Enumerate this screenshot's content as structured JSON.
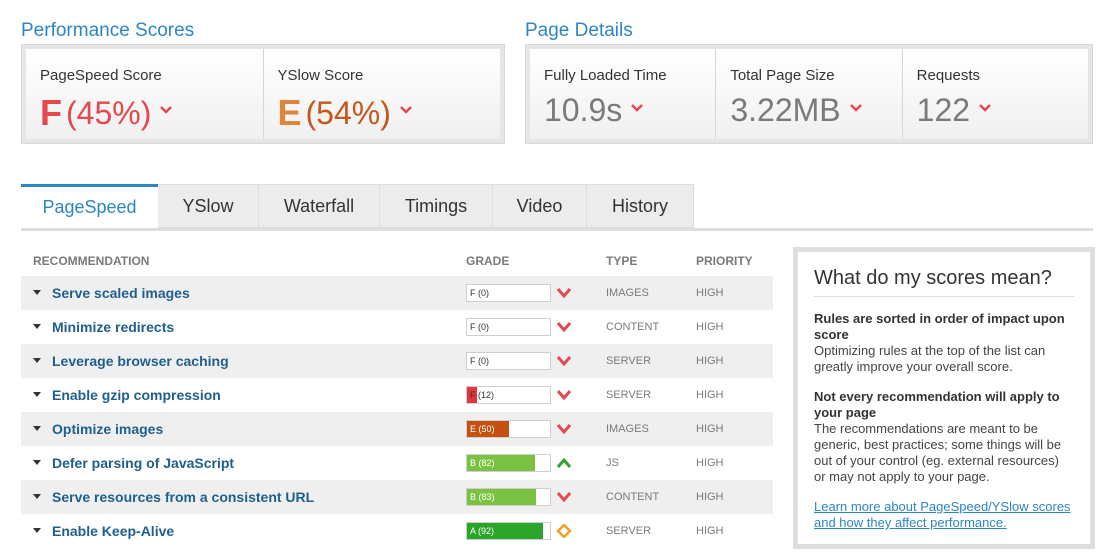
{
  "performance": {
    "title": "Performance Scores",
    "pagespeed": {
      "label": "PageSpeed Score",
      "grade": "F",
      "value": "(45%)"
    },
    "yslow": {
      "label": "YSlow Score",
      "grade": "E",
      "value": "(54%)"
    }
  },
  "details": {
    "title": "Page Details",
    "loaded": {
      "label": "Fully Loaded Time",
      "value": "10.9s"
    },
    "size": {
      "label": "Total Page Size",
      "value": "3.22MB"
    },
    "requests": {
      "label": "Requests",
      "value": "122"
    }
  },
  "tabs": [
    "PageSpeed",
    "YSlow",
    "Waterfall",
    "Timings",
    "Video",
    "History"
  ],
  "table": {
    "headers": {
      "recommendation": "RECOMMENDATION",
      "grade": "GRADE",
      "type": "TYPE",
      "priority": "PRIORITY"
    },
    "rows": [
      {
        "name": "Serve scaled images",
        "grade": "F (0)",
        "score": 0,
        "color": "#e0363c",
        "trend": "down",
        "type": "IMAGES",
        "priority": "HIGH"
      },
      {
        "name": "Minimize redirects",
        "grade": "F (0)",
        "score": 0,
        "color": "#e0363c",
        "trend": "down",
        "type": "CONTENT",
        "priority": "HIGH"
      },
      {
        "name": "Leverage browser caching",
        "grade": "F (0)",
        "score": 0,
        "color": "#e0363c",
        "trend": "down",
        "type": "SERVER",
        "priority": "HIGH"
      },
      {
        "name": "Enable gzip compression",
        "grade": "F (12)",
        "score": 12,
        "color": "#e0363c",
        "trend": "down",
        "type": "SERVER",
        "priority": "HIGH"
      },
      {
        "name": "Optimize images",
        "grade": "E (50)",
        "score": 50,
        "color": "#c4510f",
        "trend": "down",
        "type": "IMAGES",
        "priority": "HIGH"
      },
      {
        "name": "Defer parsing of JavaScript",
        "grade": "B (82)",
        "score": 82,
        "color": "#7cc242",
        "trend": "up",
        "type": "JS",
        "priority": "HIGH"
      },
      {
        "name": "Serve resources from a consistent URL",
        "grade": "B (83)",
        "score": 83,
        "color": "#7cc242",
        "trend": "down",
        "type": "CONTENT",
        "priority": "HIGH"
      },
      {
        "name": "Enable Keep-Alive",
        "grade": "A (92)",
        "score": 92,
        "color": "#2aa52a",
        "trend": "neutral",
        "type": "SERVER",
        "priority": "HIGH"
      }
    ]
  },
  "sidebar": {
    "title": "What do my scores mean?",
    "h1": "Rules are sorted in order of impact upon score",
    "p1": "Optimizing rules at the top of the list can greatly improve your overall score.",
    "h2": "Not every recommendation will apply to your page",
    "p2": "The recommendations are meant to be generic, best practices; some things will be out of your control (eg. external resources) or may not apply to your page.",
    "link": "Learn more about PageSpeed/YSlow scores and how they affect performance."
  },
  "colors": {
    "accent": "#2c86c4",
    "bad": "#e5484d",
    "good": "#7cc242"
  }
}
